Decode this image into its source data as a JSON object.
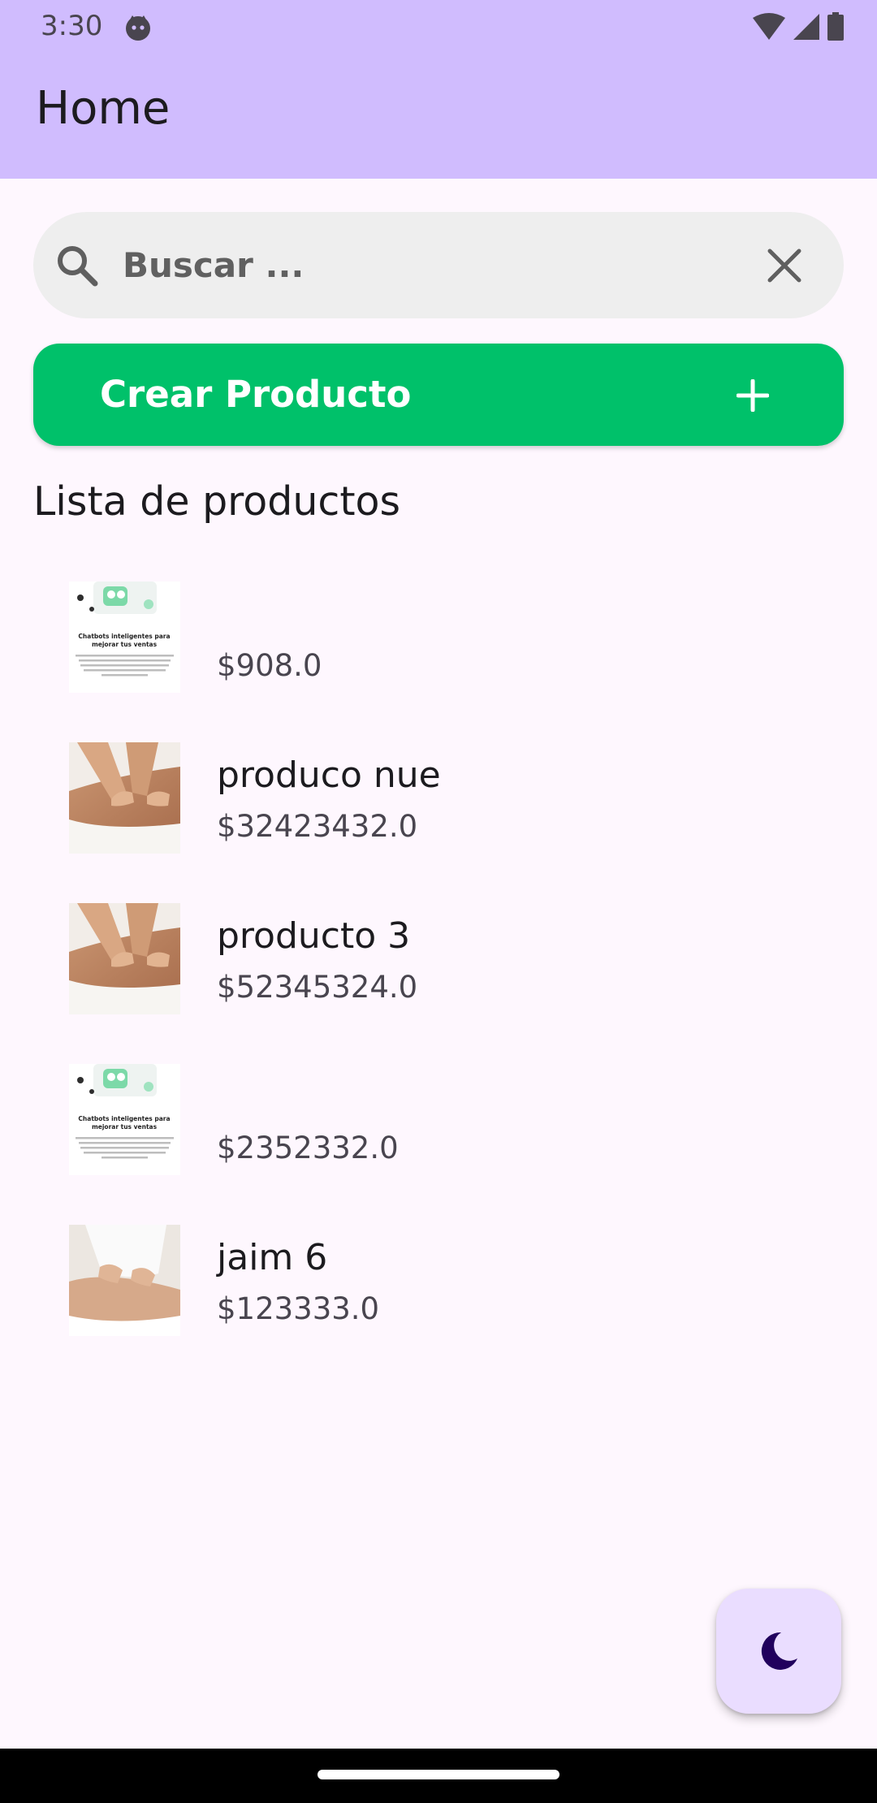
{
  "status_bar": {
    "time": "3:30"
  },
  "app_bar": {
    "title": "Home"
  },
  "search": {
    "placeholder": "Buscar ..."
  },
  "create_button": {
    "label": "Crear Producto"
  },
  "section": {
    "title": "Lista de productos"
  },
  "products": [
    {
      "name": "",
      "price": "$908.0",
      "thumbnail": "chatbot-ad-image"
    },
    {
      "name": "produco nue",
      "price": "$32423432.0",
      "thumbnail": "massage-photo"
    },
    {
      "name": "producto 3",
      "price": "$52345324.0",
      "thumbnail": "massage-photo"
    },
    {
      "name": "",
      "price": "$2352332.0",
      "thumbnail": "chatbot-ad-image"
    },
    {
      "name": "jaim 6",
      "price": "$123333.0",
      "thumbnail": "massage-photo-2"
    }
  ],
  "thumbnail_text": {
    "chatbot_headline_1": "Chatbots inteligentes para",
    "chatbot_headline_2": "mejorar tus ventas"
  },
  "fab": {
    "icon": "moon-icon"
  },
  "colors": {
    "app_bar": "#D0BCFE",
    "background": "#FEF7FE",
    "create_button": "#00C16A",
    "search_bar": "#EEEEEE",
    "fab": "#EADDFF",
    "moon": "#21005D"
  }
}
